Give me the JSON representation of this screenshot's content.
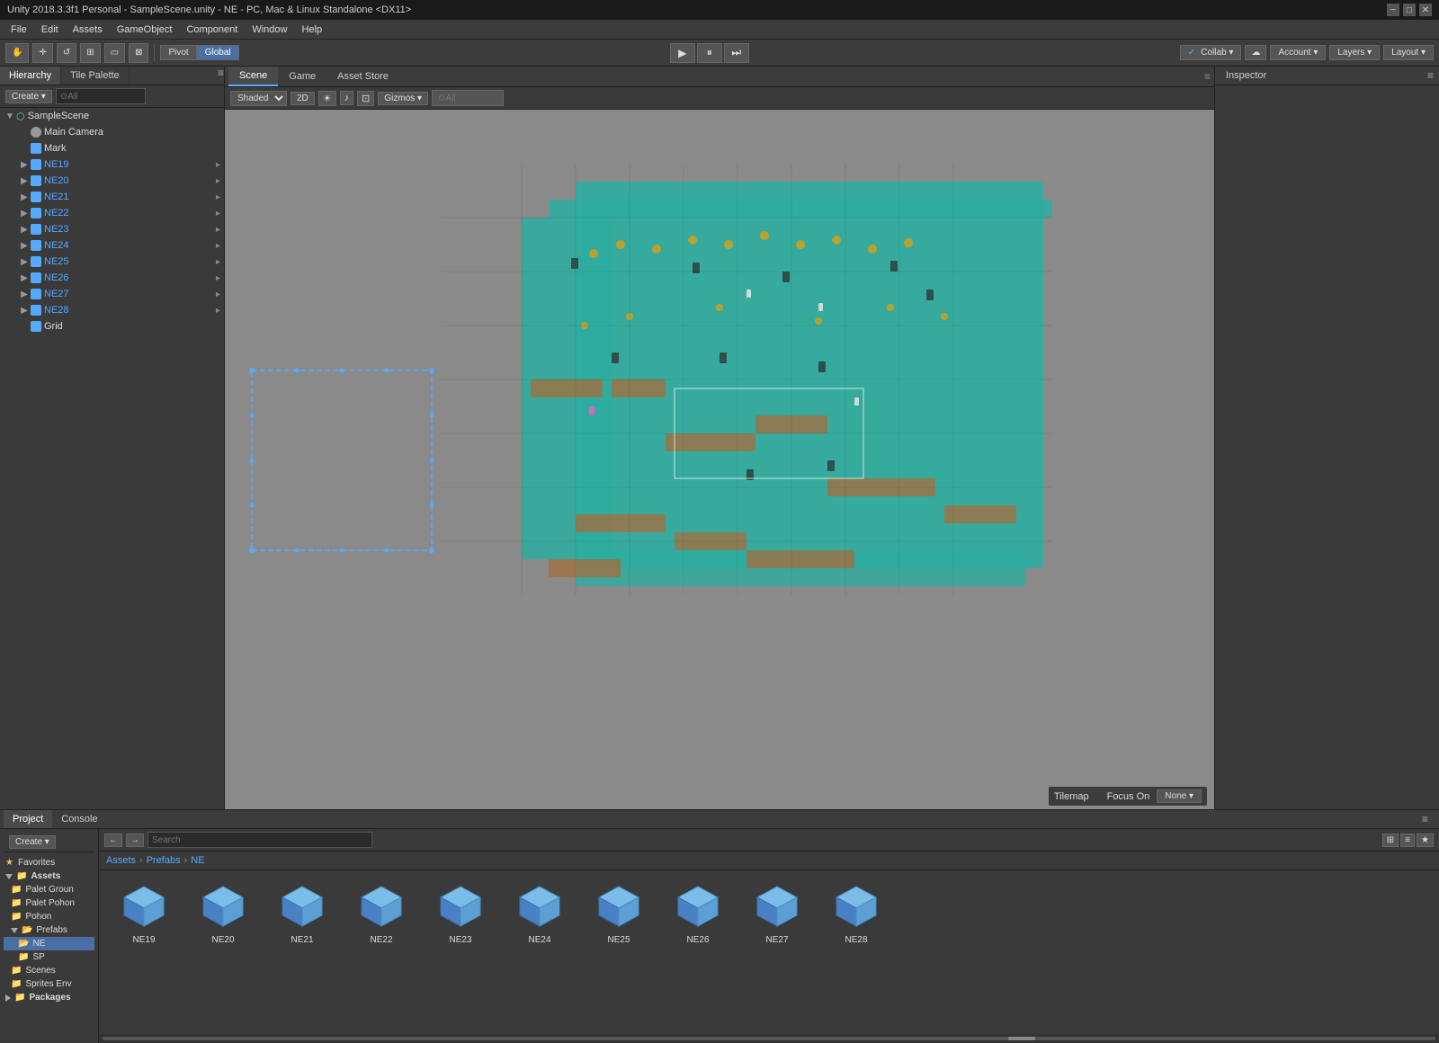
{
  "title_bar": {
    "title": "Unity 2018.3.3f1 Personal - SampleScene.unity - NE - PC, Mac & Linux Standalone <DX11>",
    "min_btn": "−",
    "max_btn": "□",
    "close_btn": "✕"
  },
  "menu": {
    "items": [
      "File",
      "Edit",
      "Assets",
      "GameObject",
      "Component",
      "Window",
      "Help"
    ]
  },
  "toolbar": {
    "hand_btn": "✋",
    "move_btn": "✛",
    "rotate_btn": "↺",
    "scale_btn": "⊞",
    "rect_btn": "⊡",
    "transform_btn": "⊠",
    "pivot_label": "Pivot",
    "global_label": "Global",
    "play_btn": "▶",
    "pause_btn": "⏸",
    "step_btn": "⏭",
    "collab_label": "Collab ▾",
    "cloud_label": "☁",
    "account_label": "Account ▾",
    "layers_label": "Layers ▾",
    "layout_label": "Layout ▾"
  },
  "hierarchy": {
    "panel_label": "Hierarchy",
    "tile_palette_label": "Tile Palette",
    "create_btn": "Create ▾",
    "search_placeholder": "⊙All",
    "scene_name": "SampleScene",
    "items": [
      {
        "label": "Main Camera",
        "indent": 1,
        "has_children": false,
        "icon": "camera"
      },
      {
        "label": "Mark",
        "indent": 1,
        "has_children": false,
        "icon": "go"
      },
      {
        "label": "NE19",
        "indent": 1,
        "has_children": true,
        "icon": "go",
        "color": "blue"
      },
      {
        "label": "NE20",
        "indent": 1,
        "has_children": true,
        "icon": "go",
        "color": "blue"
      },
      {
        "label": "NE21",
        "indent": 1,
        "has_children": true,
        "icon": "go",
        "color": "blue"
      },
      {
        "label": "NE22",
        "indent": 1,
        "has_children": true,
        "icon": "go",
        "color": "blue"
      },
      {
        "label": "NE23",
        "indent": 1,
        "has_children": true,
        "icon": "go",
        "color": "blue"
      },
      {
        "label": "NE24",
        "indent": 1,
        "has_children": true,
        "icon": "go",
        "color": "blue"
      },
      {
        "label": "NE25",
        "indent": 1,
        "has_children": true,
        "icon": "go",
        "color": "blue"
      },
      {
        "label": "NE26",
        "indent": 1,
        "has_children": true,
        "icon": "go",
        "color": "blue"
      },
      {
        "label": "NE27",
        "indent": 1,
        "has_children": true,
        "icon": "go",
        "color": "blue"
      },
      {
        "label": "NE28",
        "indent": 1,
        "has_children": true,
        "icon": "go",
        "color": "blue"
      },
      {
        "label": "Grid",
        "indent": 1,
        "has_children": false,
        "icon": "go"
      }
    ]
  },
  "scene": {
    "scene_tab": "Scene",
    "game_tab": "Game",
    "asset_store_tab": "Asset Store",
    "shaded_label": "Shaded",
    "two_d_label": "2D",
    "gizmos_label": "Gizmos ▾",
    "all_search": "⊙All",
    "tilemap_label": "Tilemap",
    "focus_on_label": "Focus On",
    "none_label": "None ▾"
  },
  "inspector": {
    "label": "Inspector"
  },
  "project": {
    "project_tab": "Project",
    "console_tab": "Console",
    "create_btn": "Create ▾",
    "search_placeholder": "Search",
    "breadcrumb": [
      "Assets",
      "Prefabs",
      "NE"
    ],
    "sidebar": {
      "favorites_label": "Favorites",
      "assets_label": "Assets",
      "items": [
        {
          "label": "Palet Groun",
          "indent": 1,
          "type": "folder"
        },
        {
          "label": "Palet Pohon",
          "indent": 1,
          "type": "folder"
        },
        {
          "label": "Pohon",
          "indent": 1,
          "type": "folder"
        },
        {
          "label": "Prefabs",
          "indent": 1,
          "type": "folder",
          "expanded": true
        },
        {
          "label": "NE",
          "indent": 2,
          "type": "folder",
          "selected": true
        },
        {
          "label": "SP",
          "indent": 2,
          "type": "folder"
        },
        {
          "label": "Scenes",
          "indent": 1,
          "type": "folder"
        },
        {
          "label": "Sprites Env",
          "indent": 1,
          "type": "folder"
        }
      ],
      "packages_label": "Packages"
    },
    "assets": [
      {
        "label": "NE19",
        "type": "prefab"
      },
      {
        "label": "NE20",
        "type": "prefab"
      },
      {
        "label": "NE21",
        "type": "prefab"
      },
      {
        "label": "NE22",
        "type": "prefab"
      },
      {
        "label": "NE23",
        "type": "prefab"
      },
      {
        "label": "NE24",
        "type": "prefab"
      },
      {
        "label": "NE25",
        "type": "prefab"
      },
      {
        "label": "NE26",
        "type": "prefab"
      },
      {
        "label": "NE27",
        "type": "prefab"
      },
      {
        "label": "NE28",
        "type": "prefab"
      }
    ]
  },
  "colors": {
    "accent_blue": "#4a80d4",
    "unity_bg": "#3c3c3c",
    "panel_bg": "#3a3a3a",
    "dark_bg": "#2a2a2a",
    "border": "#222222",
    "teal": "#2dada0",
    "cube_blue": "#5b9fd4"
  }
}
